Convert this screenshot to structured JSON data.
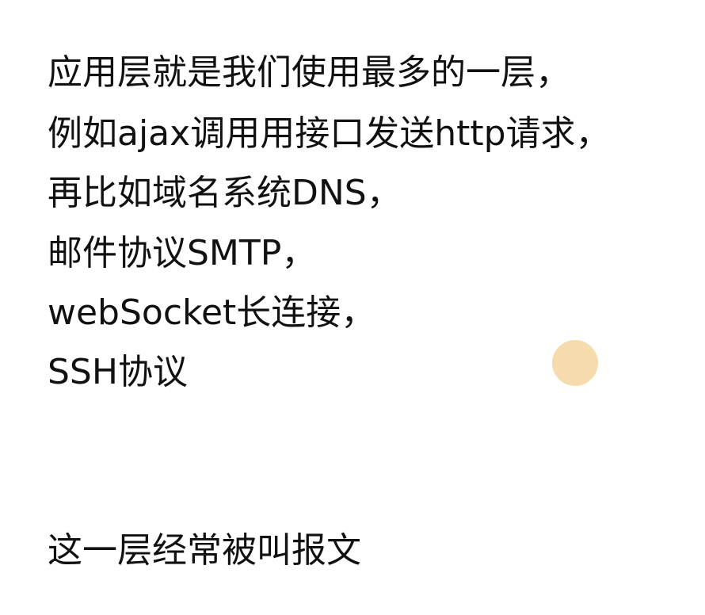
{
  "slide": {
    "lines": [
      "应用层就是我们使用最多的一层，",
      "例如ajax调用用接口发送http请求，",
      "再比如域名系统DNS，",
      "邮件协议SMTP，",
      "webSocket长连接，",
      "SSH协议"
    ],
    "footer": "这一层经常被叫报文"
  },
  "colors": {
    "background": "#ffffff",
    "text": "#111111",
    "cursor_highlight": "#f6d9a8"
  }
}
